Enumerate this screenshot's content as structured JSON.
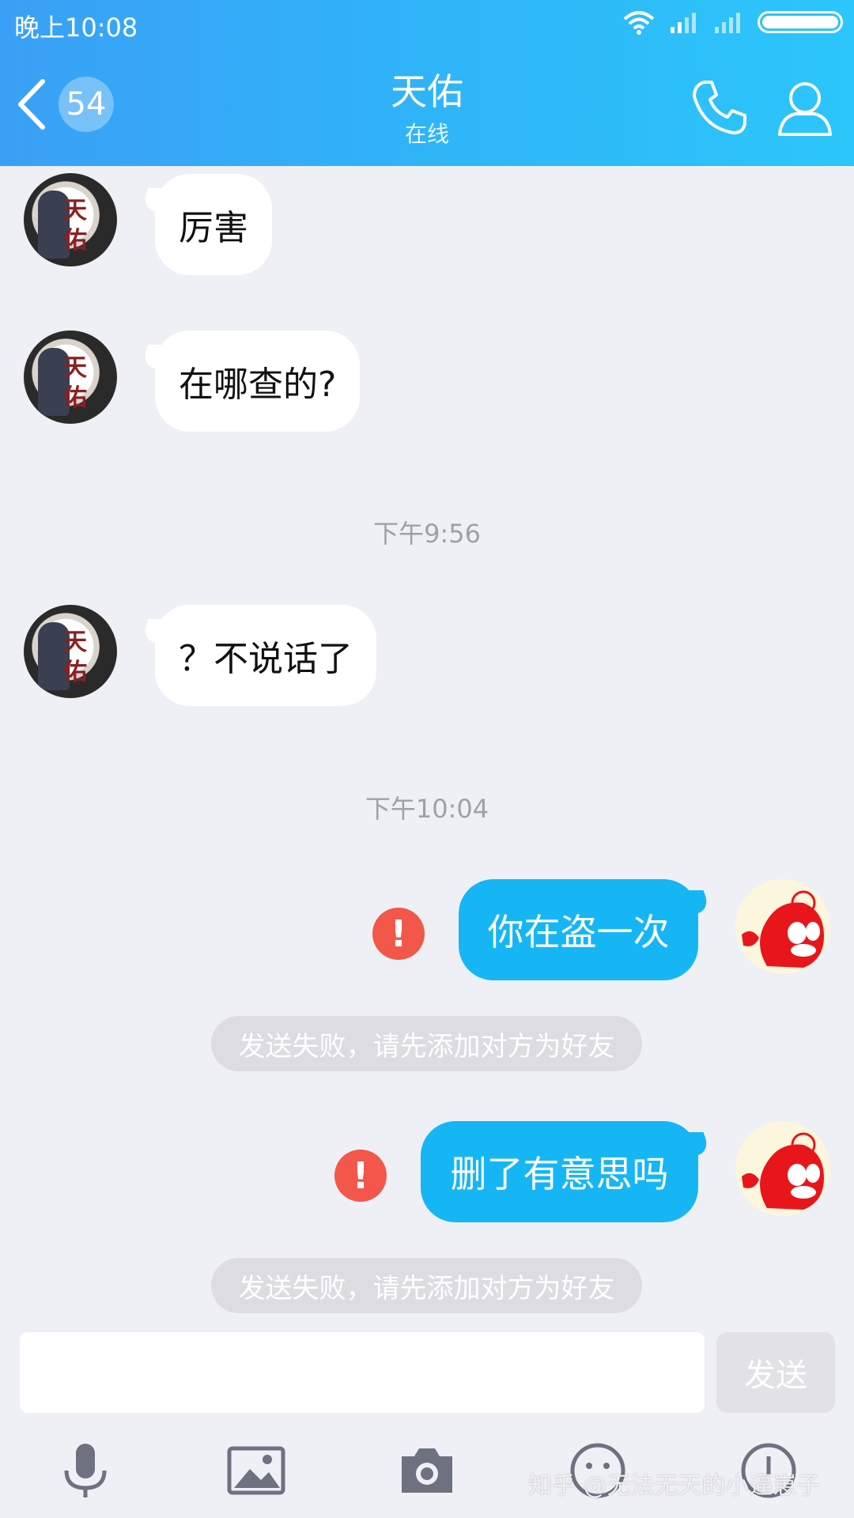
{
  "status_bar": {
    "time": "晚上10:08"
  },
  "header": {
    "unread_count": "54",
    "contact_name": "天佑",
    "contact_status": "在线",
    "accent_gradient": [
      "#3aa0f5",
      "#2cc6fa"
    ]
  },
  "avatar_left": {
    "char1": "天",
    "char2": "佑"
  },
  "messages": [
    {
      "side": "left",
      "text": "厉害"
    },
    {
      "side": "left",
      "text": "在哪查的?"
    },
    {
      "type": "time",
      "text": "下午9:56"
    },
    {
      "side": "left",
      "text": "？不说话了"
    },
    {
      "type": "time",
      "text": "下午10:04"
    },
    {
      "side": "right",
      "text": "你在盗一次",
      "error_icon": "!",
      "failed_notice": "发送失败，请先添加对方为好友"
    },
    {
      "side": "right",
      "text": "删了有意思吗",
      "error_icon": "!",
      "failed_notice": "发送失败，请先添加对方为好友"
    }
  ],
  "input": {
    "send_label": "发送"
  },
  "toolbar": {
    "icons": [
      "microphone-icon",
      "image-icon",
      "camera-icon",
      "emoji-icon",
      "more-icon"
    ]
  },
  "watermark": "知乎 @无法无天的小逼崽子"
}
